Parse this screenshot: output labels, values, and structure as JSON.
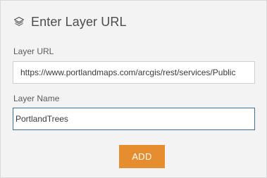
{
  "panel": {
    "title": "Enter Layer URL",
    "title_icon": "layers-icon"
  },
  "form": {
    "url_label": "Layer URL",
    "url_value": "https://www.portlandmaps.com/arcgis/rest/services/Public",
    "name_label": "Layer Name",
    "name_value": "PortlandTrees"
  },
  "actions": {
    "add_label": "ADD"
  },
  "colors": {
    "accent": "#e68d2f",
    "focus_border": "#3f6f95",
    "panel_bg": "#f3f3f3"
  }
}
